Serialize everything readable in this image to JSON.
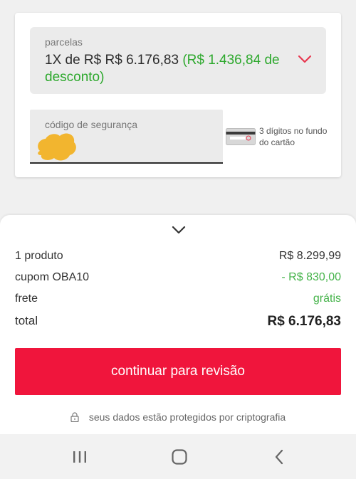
{
  "installments": {
    "label": "parcelas",
    "value_main": "1X de R$ R$ 6.176,83 ",
    "value_discount": "(R$ 1.436,84 de desconto)",
    "chevron_icon": "chevron-down-icon",
    "chevron_color": "#e8364f"
  },
  "security_code": {
    "label": "código de segurança",
    "value_redacted": true,
    "hint": "3 dígitos no fundo do cartão",
    "card_icon": "credit-card-back-icon"
  },
  "summary": {
    "collapse_icon": "chevron-down-icon",
    "rows": [
      {
        "label": "1 produto",
        "value": "R$ 8.299,99"
      },
      {
        "label": "cupom OBA10",
        "value": "- R$ 830,00"
      },
      {
        "label": "frete",
        "value": "grátis"
      },
      {
        "label": "total",
        "value": "R$ 6.176,83"
      }
    ],
    "continue_label": "continuar para revisão",
    "secure_text": "seus dados estão protegidos por criptografia",
    "lock_icon": "lock-icon"
  },
  "colors": {
    "accent": "#f0153c",
    "green": "#45b34a",
    "discount_green": "#2ca82c",
    "redaction": "#f2b52f"
  },
  "navbar": {
    "recents_icon": "recents-icon",
    "home_icon": "home-icon",
    "back_icon": "back-icon"
  }
}
